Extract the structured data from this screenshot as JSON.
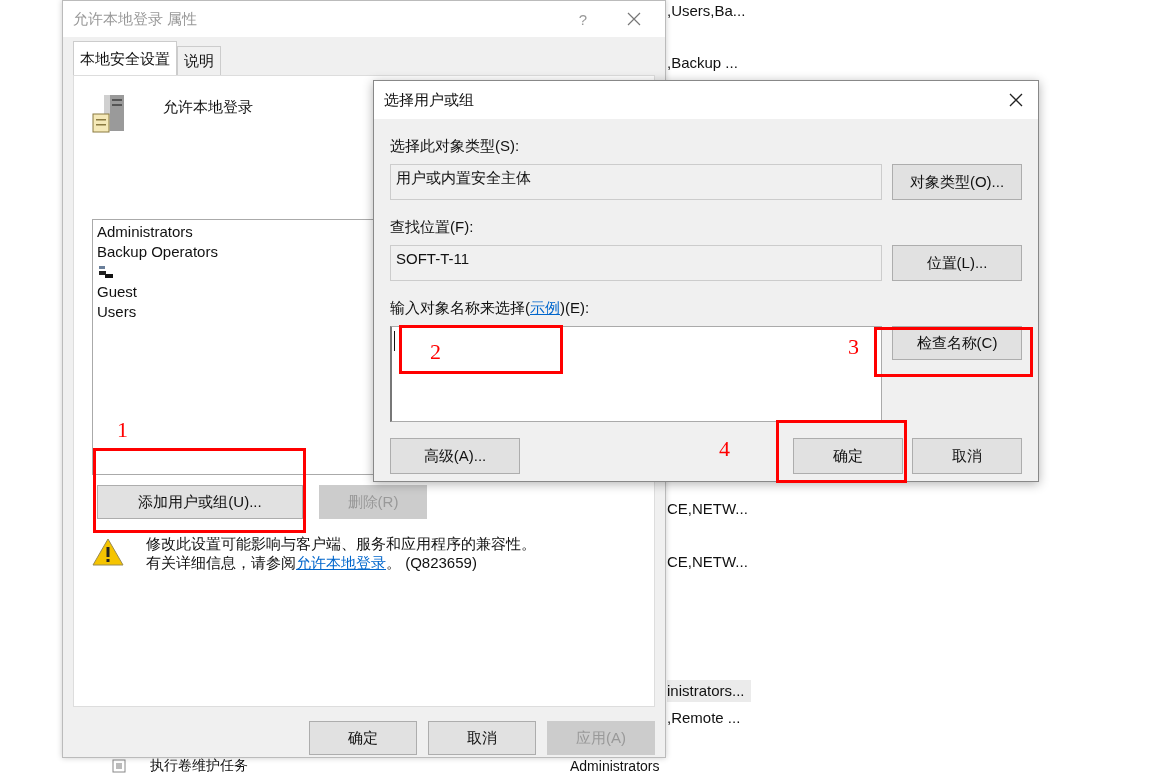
{
  "background_list": {
    "rows": [
      {
        "text": ",Users,Ba...",
        "selected": false
      },
      {
        "text": ",Backup ...",
        "selected": false
      },
      {
        "text": "CE,NETW...",
        "selected": false
      },
      {
        "text": "CE,NETW...",
        "selected": false
      },
      {
        "text": "inistrators...",
        "selected": true
      },
      {
        "text": ",Remote ...",
        "selected": false
      }
    ],
    "bottom_row": {
      "policy": "执行卷维护任务",
      "members": "Administrators"
    }
  },
  "properties_window": {
    "title": "允许本地登录 属性",
    "help": "?",
    "tabs": [
      {
        "label": "本地安全设置",
        "selected": true
      },
      {
        "label": "说明",
        "selected": false
      }
    ],
    "policy_name": "允许本地登录",
    "members": [
      {
        "kind": "name",
        "name": "Administrators"
      },
      {
        "kind": "name",
        "name": "Backup Operators"
      },
      {
        "kind": "redacted"
      },
      {
        "kind": "name",
        "name": "Guest"
      },
      {
        "kind": "name",
        "name": "Users"
      }
    ],
    "add_button": {
      "label": "添加用户或组(U)...",
      "disabled": false
    },
    "remove_button": {
      "label": "删除(R)",
      "disabled": true
    },
    "warning": {
      "line_1": "修改此设置可能影响与客户端、服务和应用程序的兼容性。",
      "line_2": "有关详细信息，请参阅",
      "link": "允许本地登录",
      "line_2_end": "。 (Q823659)"
    },
    "footer_buttons": [
      {
        "label": "确定",
        "disabled": false
      },
      {
        "label": "取消",
        "disabled": false
      },
      {
        "label": "应用(A)",
        "disabled": true
      }
    ]
  },
  "dialog": {
    "title": "选择用户或组",
    "object_type_label": "选择此对象类型(S):",
    "object_type_value": "用户或内置安全主体",
    "object_type_button": "对象类型(O)...",
    "location_label": "查找位置(F):",
    "location_value": "SOFT-T-11",
    "location_button": "位置(L)...",
    "names_label": {
      "prefix": "输入对象名称来选择(",
      "link": "示例",
      "suffix": ")(E):"
    },
    "check_names_button": "检查名称(C)",
    "advanced_button": "高级(A)...",
    "ok_button": "确定",
    "cancel_button": "取消"
  },
  "annotations": [
    {
      "label": "1"
    },
    {
      "label": "2"
    },
    {
      "label": "3"
    },
    {
      "label": "4"
    }
  ]
}
